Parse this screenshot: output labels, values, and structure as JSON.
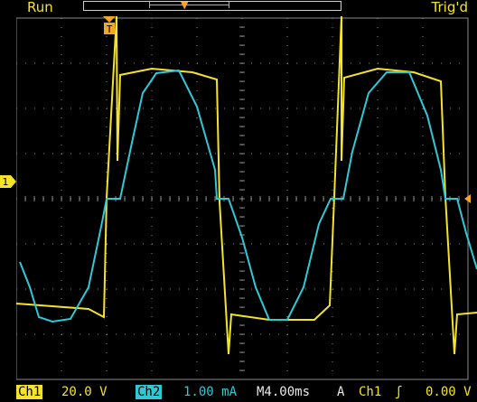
{
  "status": {
    "run": "Run",
    "trig": "Trig'd"
  },
  "trigger_marker": "T",
  "ch1_marker": "1",
  "readouts": {
    "ch1_tag": "Ch1",
    "ch1_scale": "20.0 V",
    "ch2_tag": "Ch2",
    "ch2_scale": "1.00 mA",
    "timebase": "M4.00ms",
    "trig_mode": "A",
    "trig_source": "Ch1",
    "trig_slope": "ʃ",
    "trig_level": "0.00 V"
  },
  "colors": {
    "ch1": "#f5e22a",
    "ch2": "#2fc9d6",
    "trigger": "#f5a623",
    "grid": "#8a8a8a",
    "background": "#000000"
  },
  "waveforms": {
    "ch1_description": "square wave with rounded tops",
    "ch2_description": "triangle-like wave"
  }
}
